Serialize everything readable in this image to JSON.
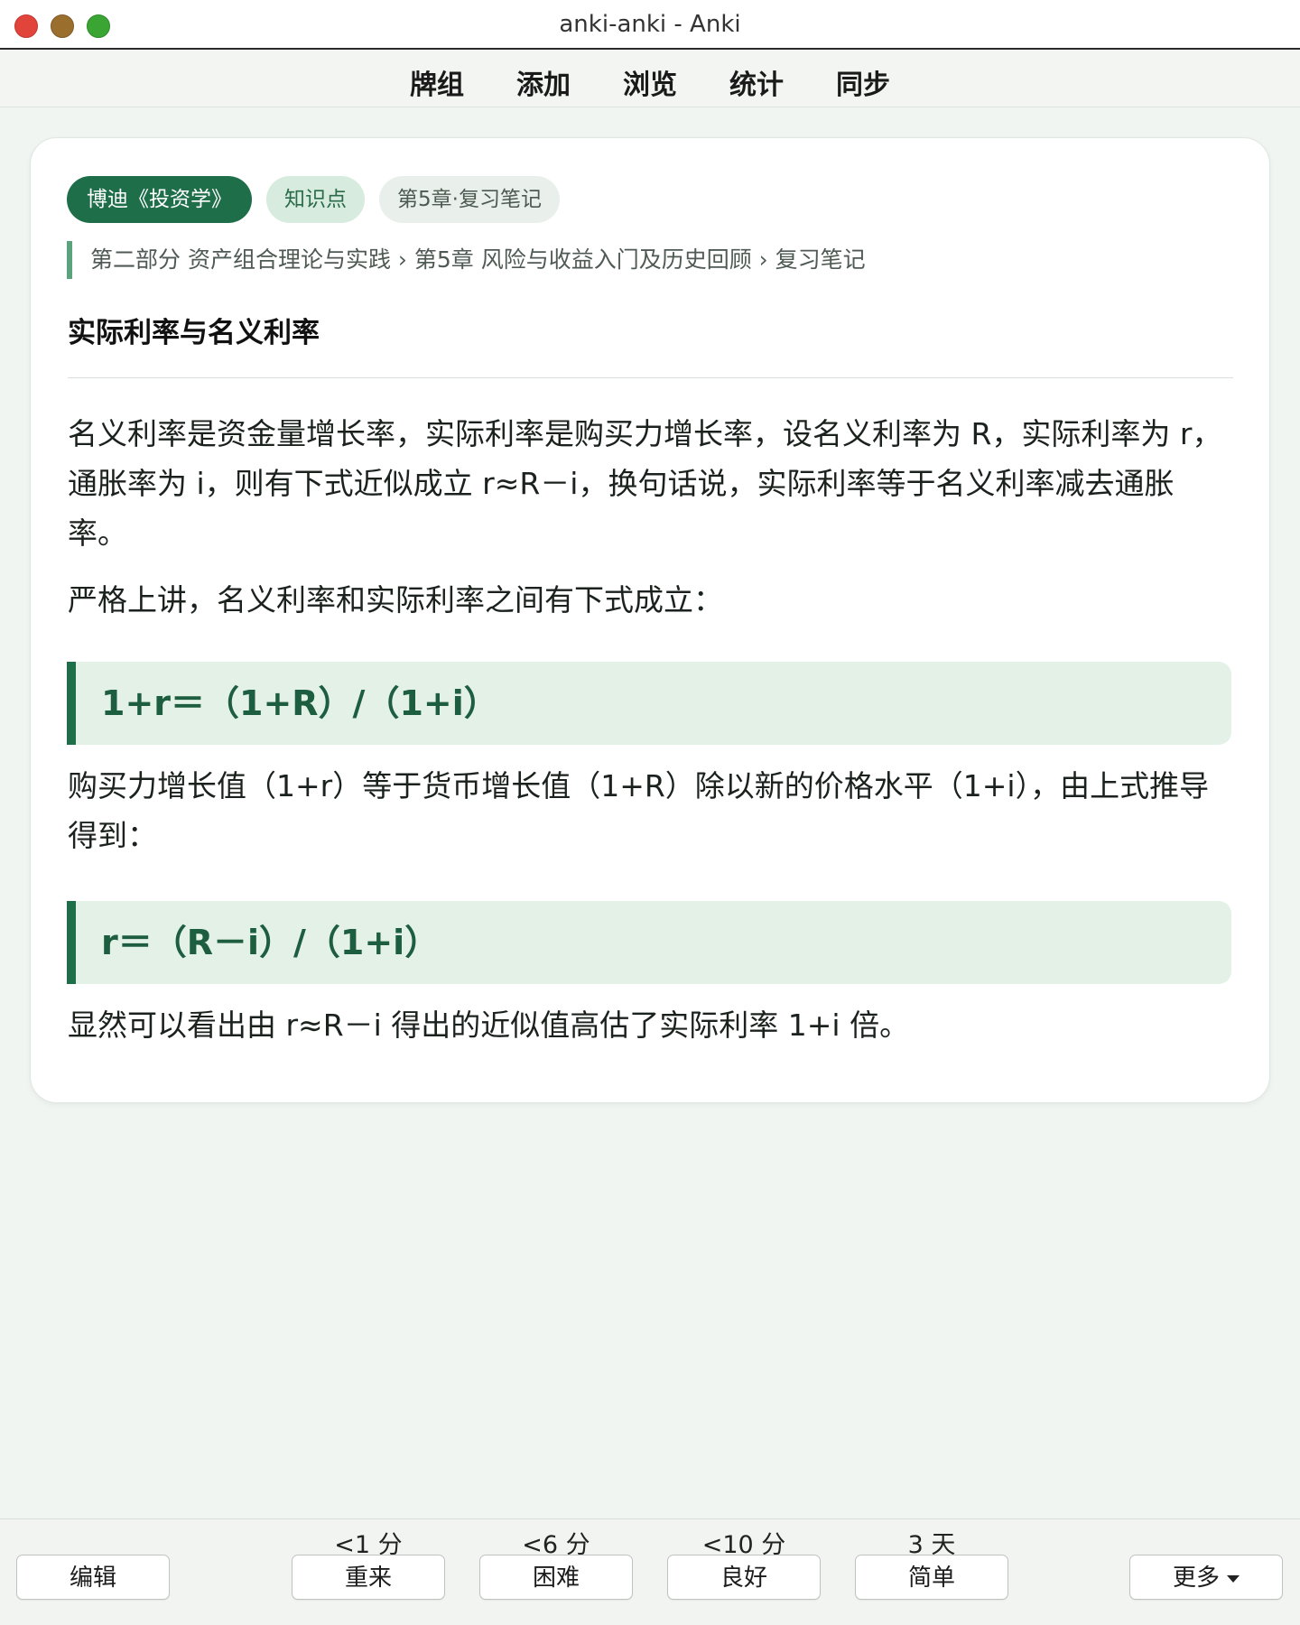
{
  "window": {
    "title": "anki-anki - Anki"
  },
  "toolbar": {
    "items": [
      "牌组",
      "添加",
      "浏览",
      "统计",
      "同步"
    ]
  },
  "card": {
    "tags": [
      "博迪《投资学》",
      "知识点",
      "第5章·复习笔记"
    ],
    "breadcrumb": "第二部分 资产组合理论与实践 › 第5章 风险与收益入门及历史回顾 › 复习笔记",
    "title": "实际利率与名义利率",
    "paragraphs": [
      "名义利率是资金量增长率，实际利率是购买力增长率，设名义利率为 R，实际利率为 r，通胀率为 i，则有下式近似成立 r≈R－i，换句话说，实际利率等于名义利率减去通胀率。",
      "严格上讲，名义利率和实际利率之间有下式成立：",
      "购买力增长值（1+r）等于货币增长值（1+R）除以新的价格水平（1+i），由上式推导得到：",
      "显然可以看出由 r≈R－i 得出的近似值高估了实际利率 1+i 倍。"
    ],
    "formulas": [
      "1+r＝（1+R）/（1+i）",
      "r＝（R－i）/（1+i）"
    ]
  },
  "review": {
    "edit_label": "编辑",
    "more_label": "更多",
    "answers": [
      {
        "label": "重来",
        "interval": "<1 分"
      },
      {
        "label": "困难",
        "interval": "<6 分"
      },
      {
        "label": "良好",
        "interval": "<10 分"
      },
      {
        "label": "简单",
        "interval": "3 天"
      }
    ]
  }
}
